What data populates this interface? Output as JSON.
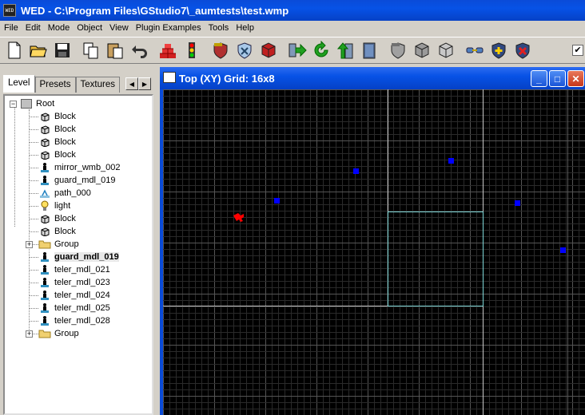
{
  "window": {
    "title": "WED - C:\\Program Files\\GStudio7\\_aumtests\\test.wmp"
  },
  "menu": [
    {
      "label": "File"
    },
    {
      "label": "Edit"
    },
    {
      "label": "Mode"
    },
    {
      "label": "Object"
    },
    {
      "label": "View"
    },
    {
      "label": "Plugin Examples"
    },
    {
      "label": "Tools"
    },
    {
      "label": "Help"
    }
  ],
  "toolbar": {
    "icons": [
      "new-file-icon",
      "open-folder-icon",
      "save-icon",
      "copy-icon",
      "paste-icon",
      "undo-icon",
      "bricks-icon",
      "traffic-light-icon",
      "hammer-shield-icon",
      "shield-x-icon",
      "red-cube-icon",
      "move-icon",
      "rotate-icon",
      "scale-icon",
      "door-icon",
      "gray-shield-icon",
      "gray-cube-icon",
      "white-cube-icon",
      "link-icon",
      "add-shield-icon",
      "remove-shield-icon"
    ],
    "checkbox_label": "✔"
  },
  "tabs": [
    {
      "label": "Level"
    },
    {
      "label": "Presets"
    },
    {
      "label": "Textures"
    }
  ],
  "tree": {
    "root": "Root",
    "children": [
      {
        "label": "Block",
        "icon": "block-icon"
      },
      {
        "label": "Block",
        "icon": "block-icon"
      },
      {
        "label": "Block",
        "icon": "block-icon"
      },
      {
        "label": "Block",
        "icon": "block-icon"
      },
      {
        "label": "mirror_wmb_002",
        "icon": "entity-icon"
      },
      {
        "label": "guard_mdl_019",
        "icon": "entity-icon"
      },
      {
        "label": "path_000",
        "icon": "path-icon"
      },
      {
        "label": "light",
        "icon": "light-bulb-icon"
      },
      {
        "label": "Block",
        "icon": "block-icon"
      },
      {
        "label": "Block",
        "icon": "block-icon"
      },
      {
        "label": "Group",
        "icon": "folder-icon"
      },
      {
        "label": "guard_mdl_019",
        "icon": "entity-icon",
        "selected": true
      },
      {
        "label": "teler_mdl_021",
        "icon": "entity-icon"
      },
      {
        "label": "teler_mdl_023",
        "icon": "entity-icon"
      },
      {
        "label": "teler_mdl_024",
        "icon": "entity-icon"
      },
      {
        "label": "teler_mdl_025",
        "icon": "entity-icon"
      },
      {
        "label": "teler_mdl_028",
        "icon": "entity-icon"
      },
      {
        "label": "Group",
        "icon": "folder-icon"
      }
    ]
  },
  "viewport": {
    "title": "Top (XY) Grid: 16x8",
    "colors": {
      "background": "#000000",
      "grid": "#2a2a2a",
      "major": "#555555",
      "outline": "#c8c8c8",
      "highlight": "#7fd8d8",
      "entity": "#0000ff",
      "selected": "#ff0000"
    }
  }
}
